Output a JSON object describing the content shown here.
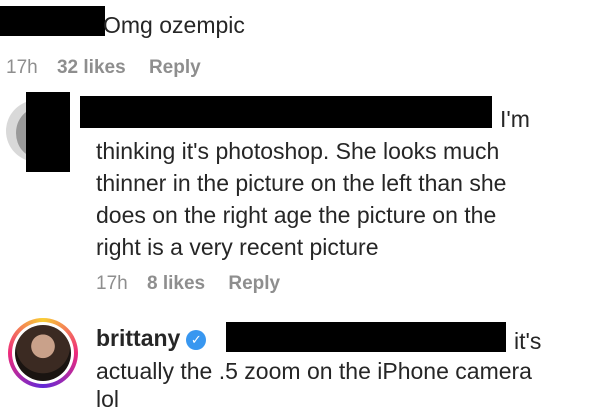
{
  "comment1": {
    "text_visible": "Omg ozempic",
    "time": "17h",
    "likes": "32 likes",
    "reply": "Reply"
  },
  "comment2": {
    "line1_tail": "I'm",
    "line2": "thinking it's photoshop. She looks much",
    "line3": "thinner in the picture on the left than she",
    "line4": "does on the right age the picture on the",
    "line5": "right is a very recent picture",
    "time": "17h",
    "likes": "8 likes",
    "reply": "Reply"
  },
  "comment3": {
    "username": "brittany",
    "verified_icon": "verified-badge-icon",
    "line1_tail": "it's",
    "line2": "actually the .5 zoom on the iPhone camera",
    "line3": "lol"
  },
  "colors": {
    "text": "#262626",
    "meta": "#8e8e8e",
    "verified": "#3897f0",
    "redaction": "#000000"
  }
}
